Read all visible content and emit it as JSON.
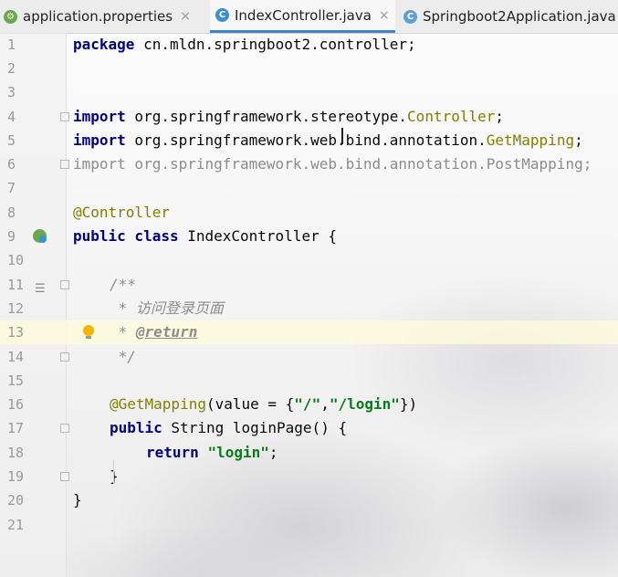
{
  "tabs": [
    {
      "label": "application.properties",
      "close": "×"
    },
    {
      "label": "IndexController.java",
      "close": "×"
    },
    {
      "label": "Springboot2Application.java"
    }
  ],
  "lines": [
    {
      "n": "1"
    },
    {
      "n": "2"
    },
    {
      "n": "3"
    },
    {
      "n": "4"
    },
    {
      "n": "5"
    },
    {
      "n": "6"
    },
    {
      "n": "7"
    },
    {
      "n": "8"
    },
    {
      "n": "9"
    },
    {
      "n": "10"
    },
    {
      "n": "11"
    },
    {
      "n": "12"
    },
    {
      "n": "13"
    },
    {
      "n": "14"
    },
    {
      "n": "15"
    },
    {
      "n": "16"
    },
    {
      "n": "17"
    },
    {
      "n": "18"
    },
    {
      "n": "19"
    },
    {
      "n": "20"
    },
    {
      "n": "21"
    }
  ],
  "code": {
    "l1": {
      "kw": "package",
      "rest": " cn.mldn.springboot2.controller;"
    },
    "l4": {
      "kw": "import",
      "pre": " org.springframework.stereotype.",
      "cls": "Controller",
      "end": ";"
    },
    "l5": {
      "kw": "import",
      "pre": " org.springframework.web.bind.annotation.",
      "cls": "GetMapping",
      "end": ";"
    },
    "l6": {
      "kw": "import",
      "rest": " org.springframework.web.bind.annotation.PostMapping;"
    },
    "l8": {
      "ann": "@Controller"
    },
    "l9": {
      "kw": "public class",
      "rest": " IndexController {"
    },
    "l11": {
      "cmt": "/**"
    },
    "l12": {
      "cmt": " * 访问登录页面"
    },
    "l13": {
      "star": " * ",
      "tag": "@return"
    },
    "l14": {
      "cmt": " */"
    },
    "l16": {
      "ann": "@GetMapping",
      "p1": "(value = {",
      "s1": "\"/\"",
      "comma": ",",
      "s2": "\"/login\"",
      "p2": "})"
    },
    "l17": {
      "kw": "public",
      "rest": " String loginPage() {"
    },
    "l18": {
      "kw": "return",
      "sp": " ",
      "str": "\"login\"",
      "end": ";"
    },
    "l19": {
      "rest": "}"
    },
    "l20": {
      "rest": "}"
    }
  }
}
